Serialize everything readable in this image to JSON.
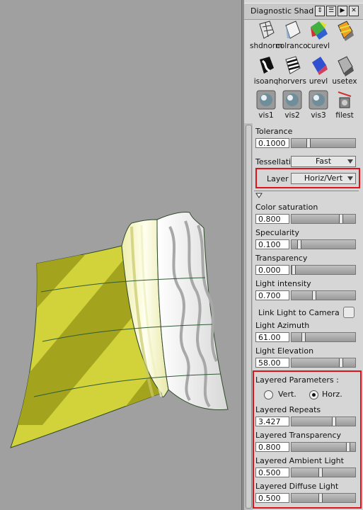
{
  "panel": {
    "title": "Diagnostic Shad",
    "titlebar_buttons": [
      "⇕",
      "☰",
      "▶",
      "✕"
    ],
    "shelf": [
      {
        "label": "shdnormul",
        "icon": "shaded-normal-icon"
      },
      {
        "label": "colrancol",
        "icon": "color-random-icon"
      },
      {
        "label": "curevl",
        "icon": "curvature-eval-icon"
      },
      {
        "label": "",
        "icon": "orange-surface-icon"
      },
      {
        "label": "isoanq",
        "icon": "isoangle-icon"
      },
      {
        "label": "horvers",
        "icon": "horizontal-stripes-icon"
      },
      {
        "label": "urevl",
        "icon": "surface-eval-icon"
      },
      {
        "label": "usetex",
        "icon": "texture-icon"
      },
      {
        "label": "vis1",
        "icon": "sphere-vis1-icon"
      },
      {
        "label": "vis2",
        "icon": "sphere-vis2-icon"
      },
      {
        "label": "vis3",
        "icon": "sphere-vis3-icon"
      },
      {
        "label": "filest",
        "icon": "file-test-icon"
      }
    ],
    "tolerance": {
      "label": "Tolerance",
      "value": "0.1000",
      "fraction": 0.25
    },
    "tessellation": {
      "label": "Tessellati",
      "value": "Fast"
    },
    "layer": {
      "label": "Layer",
      "value": "Horiz/Vert"
    },
    "color_saturation": {
      "label": "Color saturation",
      "value": "0.800",
      "fraction": 0.8
    },
    "specularity": {
      "label": "Specularity",
      "value": "0.100",
      "fraction": 0.1
    },
    "transparency": {
      "label": "Transparency",
      "value": "0.000",
      "fraction": 0.0
    },
    "light_intensity": {
      "label": "Light intensity",
      "value": "0.700",
      "fraction": 0.35
    },
    "link_light": {
      "label": "Link Light to Camera",
      "checked": false
    },
    "light_azimuth": {
      "label": "Light Azimuth",
      "value": "61.00",
      "fraction": 0.17
    },
    "light_elevation": {
      "label": "Light Elevation",
      "value": "58.00",
      "fraction": 0.8
    },
    "layered_params": {
      "label": "Layered Parameters :",
      "vert": "Vert.",
      "horz": "Horz.",
      "selected": "Horz."
    },
    "layered_repeats": {
      "label": "Layered Repeats",
      "value": "3.427",
      "fraction": 0.68
    },
    "layered_transparency": {
      "label": "Layered Transparency",
      "value": "0.800",
      "fraction": 0.92
    },
    "layered_ambient": {
      "label": "Layered Ambient Light",
      "value": "0.500",
      "fraction": 0.45
    },
    "layered_diffuse": {
      "label": "Layered Diffuse Light",
      "value": "0.500",
      "fraction": 0.45
    }
  },
  "colors": {
    "highlight": "#e0121a",
    "surface_yellow": "#d2d23a",
    "surface_dark": "#a3a31e",
    "viewport_bg": "#a0a0a0"
  }
}
